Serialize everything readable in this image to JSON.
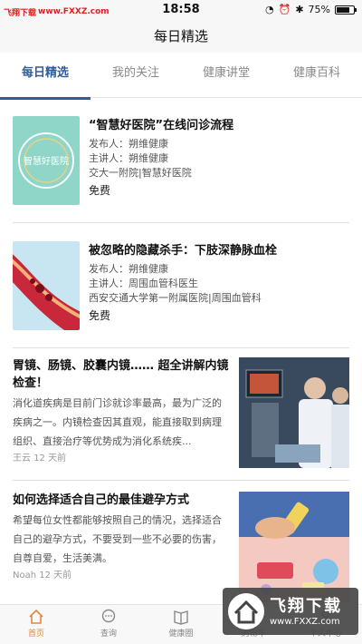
{
  "watermark": {
    "brand": "飞翔下载",
    "url": "www.FXXZ.com"
  },
  "status_bar": {
    "time": "18:58",
    "battery": "75%",
    "battery_level": 0.75
  },
  "nav": {
    "title": "每日精选"
  },
  "tabs": [
    {
      "label": "每日精选",
      "active": true
    },
    {
      "label": "我的关注",
      "active": false
    },
    {
      "label": "健康讲堂",
      "active": false
    },
    {
      "label": "健康百科",
      "active": false
    }
  ],
  "courses": [
    {
      "title": "“智慧好医院”在线问诊流程",
      "publisher": "发布人：朔维健康",
      "speaker": "主讲人：朔维健康",
      "org": "交大一附院|智慧好医院",
      "price": "免费",
      "thumb_text": "智慧好医院"
    },
    {
      "title": "被忽略的隐藏杀手：下肢深静脉血栓",
      "publisher": "发布人：朔维健康",
      "speaker": "主讲人：周围血管科医生",
      "org": "西安交通大学第一附属医院|周围血管科",
      "price": "免费"
    }
  ],
  "articles": [
    {
      "title": "胃镜、肠镜、胶囊内镜…… 超全讲解内镜检查！",
      "summary": "消化道疾病是目前门诊就诊率最高，最为广泛的疾病之一。内镜检查因其直观，能直接取到病理组织、直接治疗等优势成为消化系统疾...",
      "author": "王云",
      "time": "12 天前"
    },
    {
      "title": "如何选择适合自己的最佳避孕方式",
      "summary": "希望每位女性都能够按照自己的情况，选择适合自己的避孕方式，不要受到一些不必要的伤害，自尊自爱，生活美满。",
      "author": "Noah",
      "time": "12 天前"
    }
  ],
  "bottom_nav": [
    {
      "label": "首页",
      "icon": "home-icon",
      "active": true
    },
    {
      "label": "查询",
      "icon": "chat-icon",
      "active": false
    },
    {
      "label": "健康圈",
      "icon": "book-icon",
      "active": false
    },
    {
      "label": "购物车",
      "icon": "cart-icon",
      "active": false
    },
    {
      "label": "个人中心",
      "icon": "person-icon",
      "active": false
    }
  ],
  "corner_badge": {
    "title": "飞翔下载",
    "url": "www.FXXZ.com"
  },
  "colors": {
    "accent": "#2f5d9a",
    "home_active": "#e0873a",
    "watermark": "#e02020",
    "thumb_teal": "#8fd6c8"
  }
}
